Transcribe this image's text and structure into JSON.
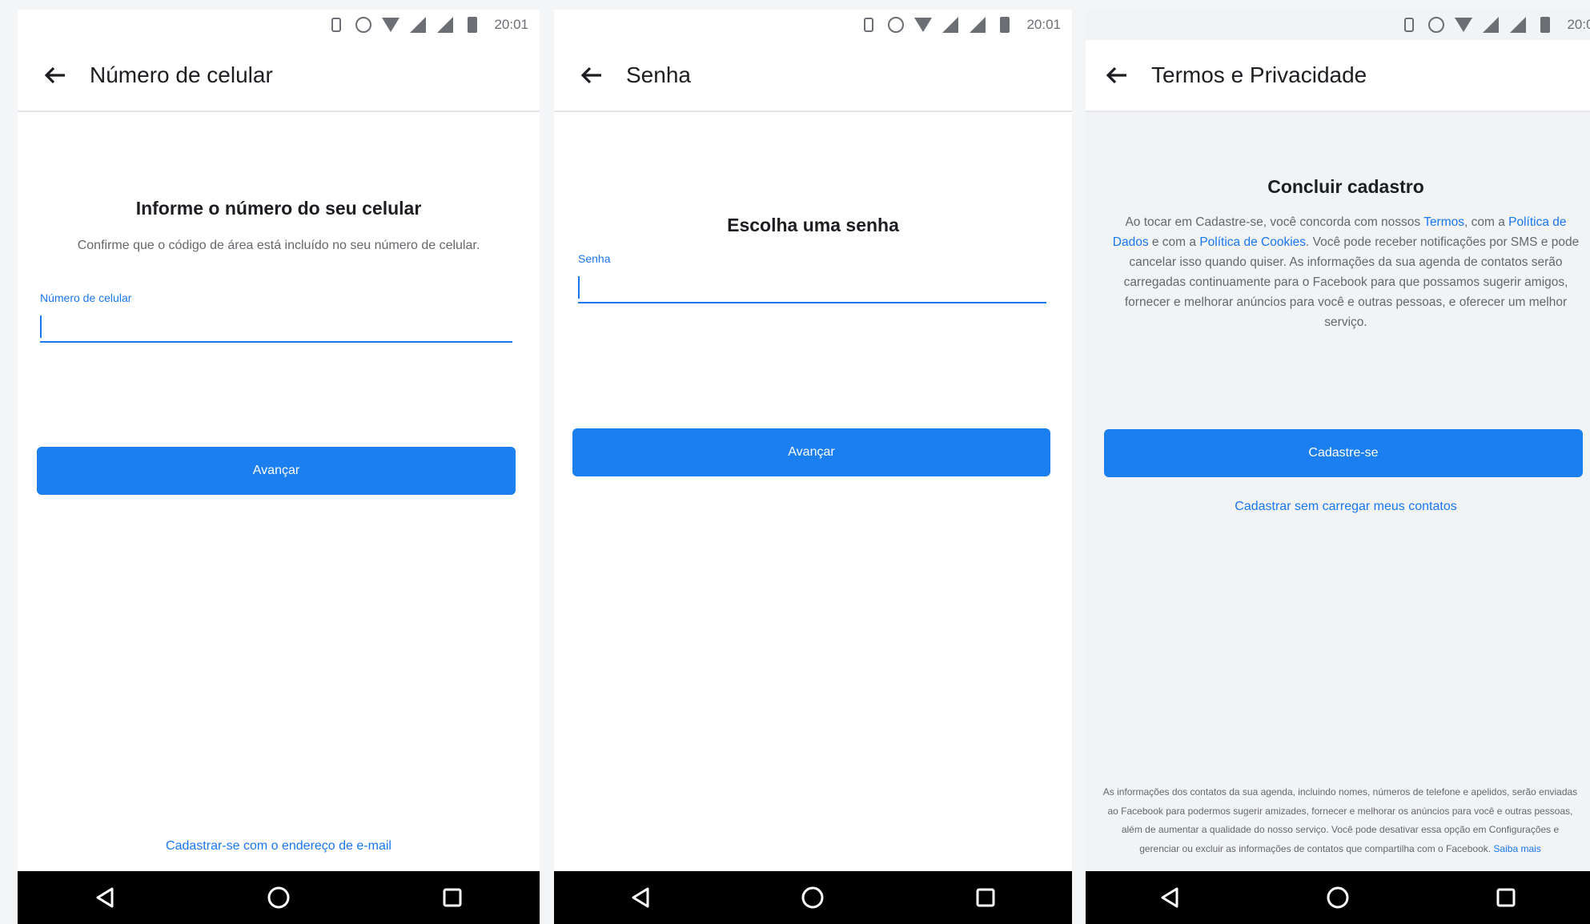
{
  "status_bar": {
    "time": "20:01"
  },
  "screens": [
    {
      "title": "Número de celular",
      "heading": "Informe o número do seu celular",
      "subtitle": "Confirme que o código de área está incluído no seu número de celular.",
      "field_label": "Número de celular",
      "button_label": "Avançar",
      "email_link": "Cadastrar-se com o endereço de e-mail"
    },
    {
      "title": "Senha",
      "heading": "Escolha uma senha",
      "field_label": "Senha",
      "button_label": "Avançar"
    },
    {
      "title": "Termos e Privacidade",
      "heading": "Concluir cadastro",
      "terms": {
        "t1": "Ao tocar em Cadastre-se, você concorda com nossos ",
        "link_terms": "Termos",
        "t2": ", com a ",
        "link_data_policy": "Política de Dados",
        "t3": " e com a ",
        "link_cookies": "Política de Cookies",
        "t4": ". Você pode receber notificações por SMS e pode cancelar isso quando quiser. As informações da sua agenda de contatos serão carregadas continuamente para o Facebook para que possamos sugerir amigos, fornecer e melhorar anúncios para você e outras pessoas, e oferecer um melhor serviço."
      },
      "button_label": "Cadastre-se",
      "no_contacts_link": "Cadastrar sem carregar meus contatos",
      "footer": {
        "text": "As informações dos contatos da sua agenda, incluindo nomes, números de telefone e apelidos, serão enviadas ao Facebook para podermos sugerir amizades, fornecer e melhorar os anúncios para você e outras pessoas, além de aumentar a qualidade do nosso serviço. Você pode desativar essa opção em Configurações e gerenciar ou excluir as informações de contatos que compartilha com o Facebook. ",
        "learn_more": "Saiba mais"
      }
    }
  ]
}
